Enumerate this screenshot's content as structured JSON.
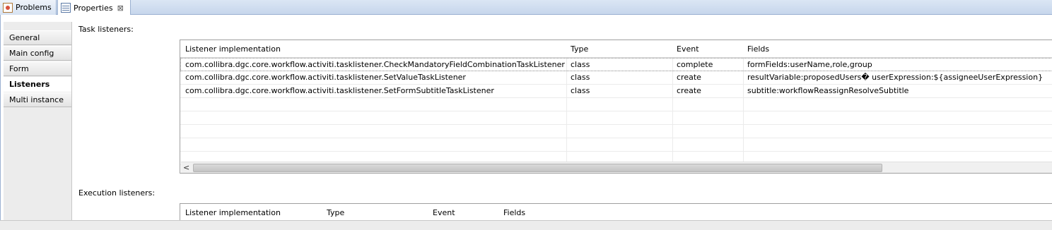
{
  "tabs": {
    "problems": "Problems",
    "properties": "Properties",
    "close_glyph": "⊠"
  },
  "sidebar": {
    "items": [
      {
        "label": "General"
      },
      {
        "label": "Main config"
      },
      {
        "label": "Form"
      },
      {
        "label": "Listeners",
        "active": true
      },
      {
        "label": "Multi instance"
      }
    ]
  },
  "task_listeners": {
    "label": "Task listeners:",
    "columns": [
      "Listener implementation",
      "Type",
      "Event",
      "Fields"
    ],
    "rows": [
      [
        "com.collibra.dgc.core.workflow.activiti.tasklistener.CheckMandatoryFieldCombinationTaskListener",
        "class",
        "complete",
        "formFields:userName,role,group"
      ],
      [
        "com.collibra.dgc.core.workflow.activiti.tasklistener.SetValueTaskListener",
        "class",
        "create",
        "resultVariable:proposedUsers� userExpression:${assigneeUserExpression}"
      ],
      [
        "com.collibra.dgc.core.workflow.activiti.tasklistener.SetFormSubtitleTaskListener",
        "class",
        "create",
        "subtitle:workflowReassignResolveSubtitle"
      ]
    ],
    "scroll_left_glyph": "<"
  },
  "execution_listeners": {
    "label": "Execution listeners:",
    "columns": [
      "Listener implementation",
      "Type",
      "Event",
      "Fields"
    ]
  }
}
